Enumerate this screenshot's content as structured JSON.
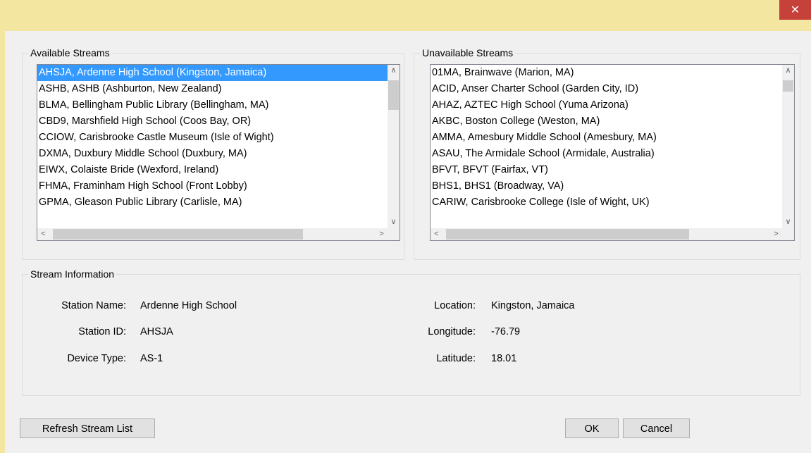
{
  "window": {
    "close_glyph": "✕"
  },
  "available": {
    "title": "Available Streams",
    "items": [
      "AHSJA, Ardenne High School (Kingston, Jamaica)",
      "ASHB, ASHB (Ashburton, New Zealand)",
      "BLMA, Bellingham Public Library (Bellingham, MA)",
      "CBD9, Marshfield High School (Coos Bay, OR)",
      "CCIOW, Carisbrooke Castle Museum (Isle of Wight)",
      "DXMA, Duxbury Middle School (Duxbury, MA)",
      "EIWX, Colaiste Bride (Wexford, Ireland)",
      "FHMA, Framinham High School (Front Lobby)",
      "GPMA, Gleason Public Library (Carlisle, MA)"
    ],
    "selected_index": 0
  },
  "unavailable": {
    "title": "Unavailable Streams",
    "items": [
      "01MA, Brainwave (Marion, MA)",
      "ACID, Anser Charter School (Garden City, ID)",
      "AHAZ, AZTEC High School (Yuma Arizona)",
      "AKBC, Boston College (Weston, MA)",
      "AMMA, Amesbury Middle School (Amesbury, MA)",
      "ASAU, The Armidale School (Armidale, Australia)",
      "BFVT, BFVT (Fairfax, VT)",
      "BHS1, BHS1 (Broadway, VA)",
      "CARIW, Carisbrooke College (Isle of Wight, UK)"
    ]
  },
  "scroll": {
    "up": "∧",
    "down": "∨",
    "left": "<",
    "right": ">"
  },
  "info": {
    "title": "Stream Information",
    "station_name_label": "Station Name:",
    "station_name": "Ardenne High School",
    "station_id_label": "Station ID:",
    "station_id": "AHSJA",
    "device_type_label": "Device Type:",
    "device_type": "AS-1",
    "location_label": "Location:",
    "location": "Kingston, Jamaica",
    "longitude_label": "Longitude:",
    "longitude": "-76.79",
    "latitude_label": "Latitude:",
    "latitude": "18.01"
  },
  "buttons": {
    "refresh": "Refresh Stream List",
    "ok": "OK",
    "cancel": "Cancel"
  },
  "colors": {
    "titlebar": "#f3e6a0",
    "close": "#c7413b",
    "selection": "#3399ff"
  }
}
